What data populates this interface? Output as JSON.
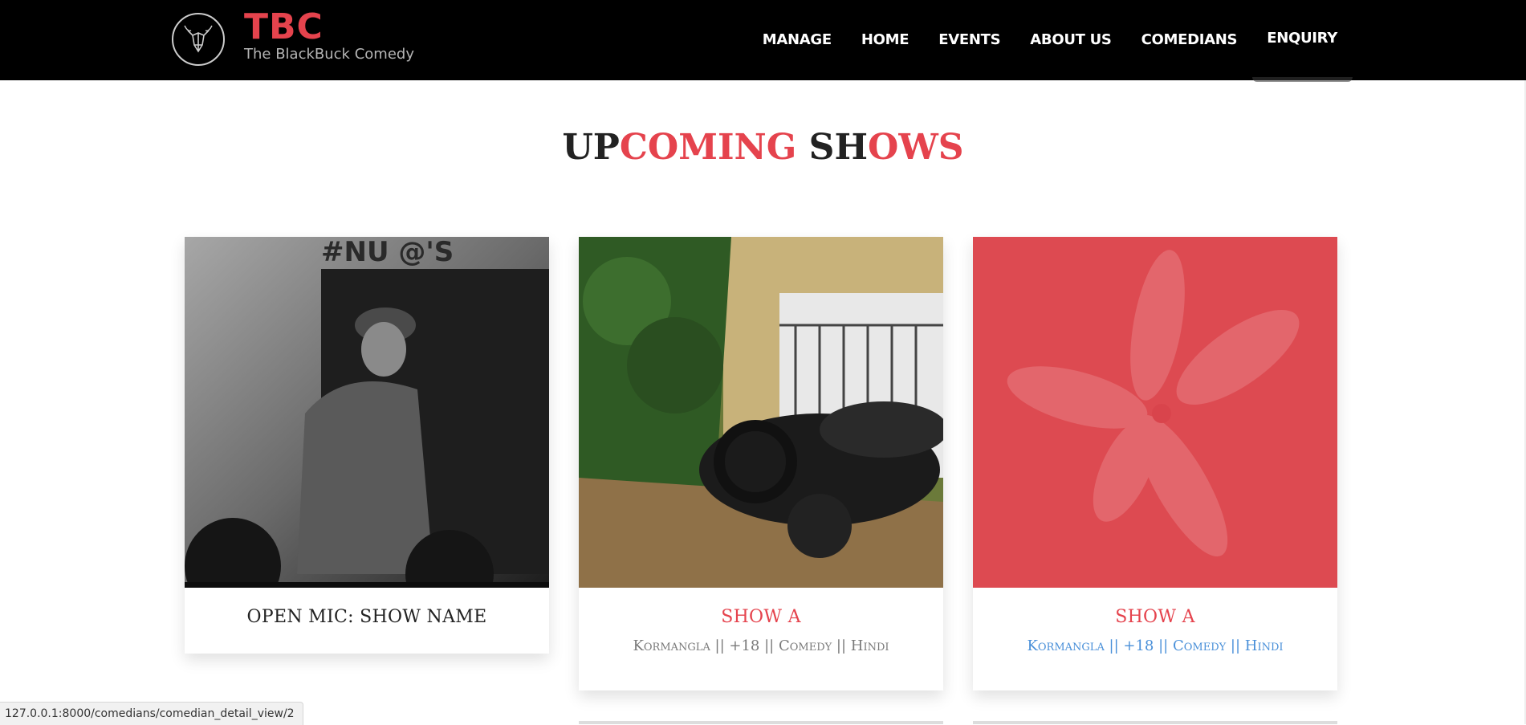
{
  "header": {
    "brand_title": "TBC",
    "brand_subtitle": "The BlackBuck Comedy",
    "nav": [
      "MANAGE",
      "HOME",
      "EVENTS",
      "ABOUT US",
      "COMEDIANS",
      "ENQUIRY"
    ]
  },
  "section": {
    "heading_parts": [
      {
        "text": "UP",
        "tone": "dark"
      },
      {
        "text": "COMING",
        "tone": "red"
      },
      {
        "text": " SH",
        "tone": "dark"
      },
      {
        "text": "OWS",
        "tone": "red"
      }
    ]
  },
  "cards": [
    {
      "title": "OPEN MIC: SHOW NAME",
      "meta": ""
    },
    {
      "title": "SHOW A",
      "meta": "Kormangla || +18 || Comedy || Hindi"
    },
    {
      "title": "SHOW A",
      "meta": "Kormangla || +18 || Comedy || Hindi"
    }
  ],
  "status_bar": {
    "url": "127.0.0.1:8000/comedians/comedian_detail_view/2"
  },
  "colors": {
    "accent": "#e5434d",
    "navbar_bg": "#000000",
    "link_blue": "#4a90d9"
  }
}
